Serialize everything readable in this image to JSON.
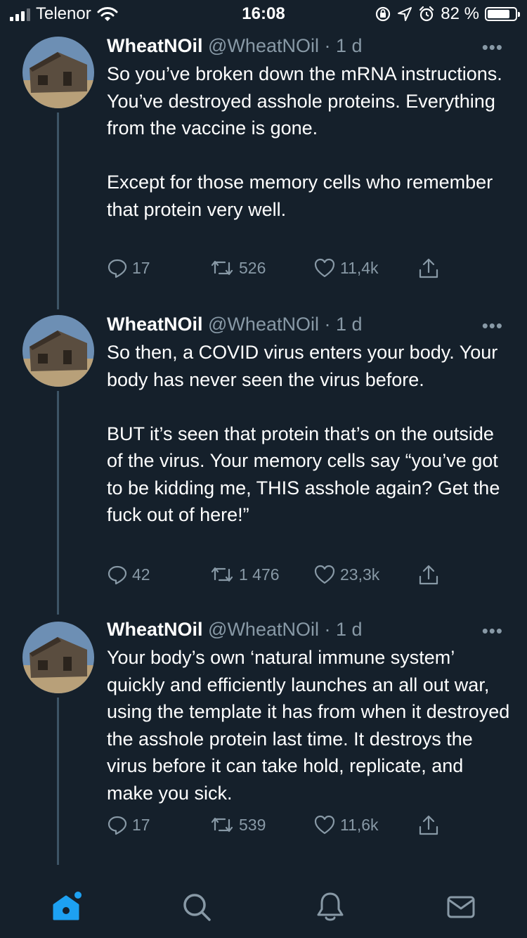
{
  "status_bar": {
    "carrier": "Telenor",
    "time": "16:08",
    "battery": "82 %",
    "battery_level": 0.82
  },
  "tweets": [
    {
      "name": "WheatNOil",
      "handle": "@WheatNOil",
      "sep": "·",
      "time": "1 d",
      "more": "•••",
      "text": "So you’ve broken down the mRNA instructions. You’ve destroyed asshole proteins. Everything from the vaccine is gone.\n\nExcept for those memory cells who remember that protein very well.",
      "replies": "17",
      "retweets": "526",
      "likes": "11,4k"
    },
    {
      "name": "WheatNOil",
      "handle": "@WheatNOil",
      "sep": "·",
      "time": "1 d",
      "more": "•••",
      "text": "So then, a COVID virus enters your body. Your body has never seen the virus before.\n\nBUT it’s seen that protein that’s on the outside of the virus. Your memory cells say “you’ve got to be kidding me, THIS asshole again? Get the fuck out of here!”",
      "replies": "42",
      "retweets": "1 476",
      "likes": "23,3k"
    },
    {
      "name": "WheatNOil",
      "handle": "@WheatNOil",
      "sep": "·",
      "time": "1 d",
      "more": "•••",
      "text": "Your body’s own ‘natural immune system’ quickly and efficiently launches an all out war, using the template it has from when it destroyed the asshole protein last time. It destroys the virus before it can take hold, replicate, and make you sick.",
      "replies": "17",
      "retweets": "539",
      "likes": "11,6k"
    }
  ],
  "bottom_nav": [
    {
      "icon": "home-icon",
      "active": true
    },
    {
      "icon": "search-icon",
      "active": false
    },
    {
      "icon": "notifications-icon",
      "active": false
    },
    {
      "icon": "messages-icon",
      "active": false
    }
  ],
  "colors": {
    "background": "#15202b",
    "muted": "#8899a6",
    "accent": "#1da1f2",
    "thread_line": "#3d5466"
  }
}
